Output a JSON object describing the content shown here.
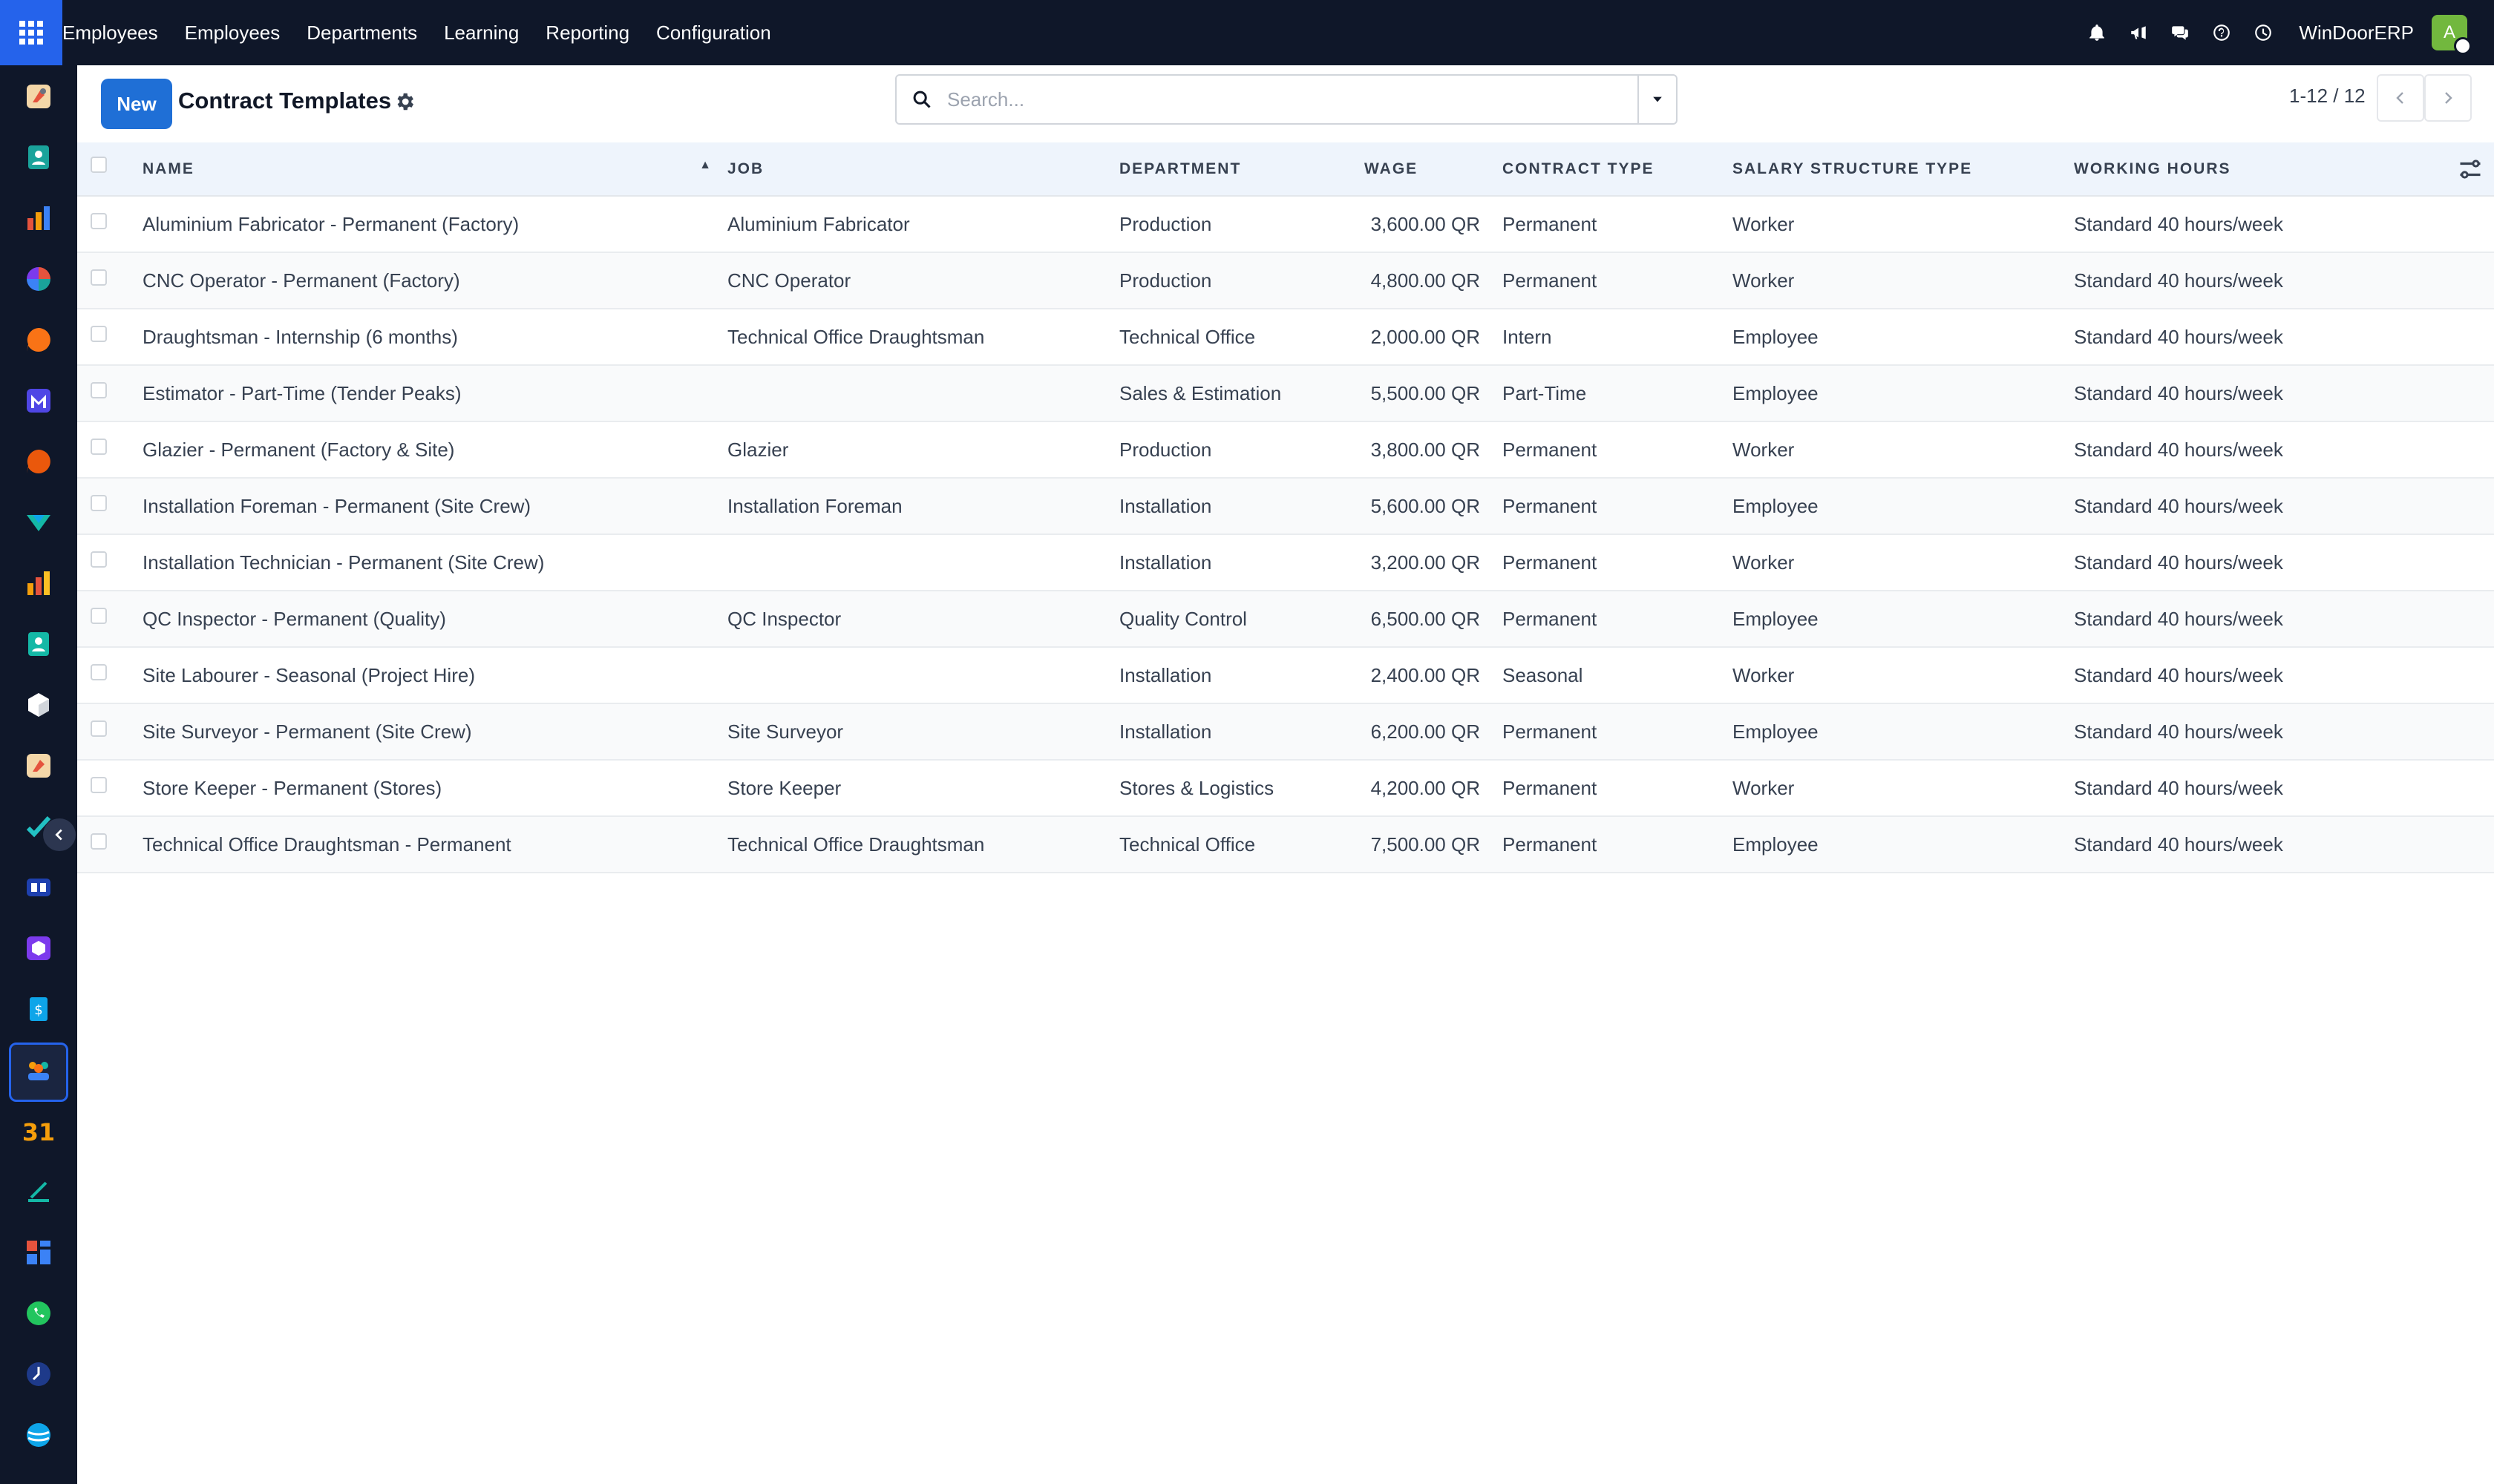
{
  "topbar": {
    "nav": [
      "Employees",
      "Employees",
      "Departments",
      "Learning",
      "Reporting",
      "Configuration"
    ],
    "company": "WinDoorERP",
    "avatar_letter": "A",
    "accent": "#2563eb",
    "icons": [
      "bell-icon",
      "megaphone-icon",
      "chat-icon",
      "help-icon",
      "clock-icon"
    ]
  },
  "sidebar": {
    "apps": [
      "studio-app-icon",
      "contacts-app-icon",
      "reporting-app-icon",
      "dashboard-app-icon",
      "discuss-app-icon",
      "mail-app-icon",
      "livechat-app-icon",
      "documents-app-icon",
      "statistics-app-icon",
      "contacts-app-icon",
      "inventory-app-icon",
      "studio-app-icon",
      "project-app-icon",
      "helpdesk-app-icon",
      "products-app-icon",
      "invoicing-app-icon",
      "employees-app-icon",
      "calendar-app-icon",
      "sign-app-icon",
      "kanban-app-icon",
      "whatsapp-app-icon",
      "timesheet-app-icon",
      "website-app-icon"
    ],
    "calendar_label": "31"
  },
  "control": {
    "new_label": "New",
    "title": "Contract Templates",
    "search_placeholder": "Search...",
    "pager": "1-12 / 12"
  },
  "table": {
    "columns": [
      "NAME",
      "JOB",
      "DEPARTMENT",
      "WAGE",
      "CONTRACT TYPE",
      "SALARY STRUCTURE TYPE",
      "WORKING HOURS"
    ],
    "rows": [
      {
        "name": "Aluminium Fabricator - Permanent (Factory)",
        "job": "Aluminium Fabricator",
        "department": "Production",
        "wage": "3,600.00 QR",
        "contract_type": "Permanent",
        "salary_structure": "Worker",
        "working_hours": "Standard 40 hours/week"
      },
      {
        "name": "CNC Operator - Permanent (Factory)",
        "job": "CNC Operator",
        "department": "Production",
        "wage": "4,800.00 QR",
        "contract_type": "Permanent",
        "salary_structure": "Worker",
        "working_hours": "Standard 40 hours/week"
      },
      {
        "name": "Draughtsman - Internship (6 months)",
        "job": "Technical Office Draughtsman",
        "department": "Technical Office",
        "wage": "2,000.00 QR",
        "contract_type": "Intern",
        "salary_structure": "Employee",
        "working_hours": "Standard 40 hours/week"
      },
      {
        "name": "Estimator - Part-Time (Tender Peaks)",
        "job": "",
        "department": "Sales & Estimation",
        "wage": "5,500.00 QR",
        "contract_type": "Part-Time",
        "salary_structure": "Employee",
        "working_hours": "Standard 40 hours/week"
      },
      {
        "name": "Glazier - Permanent (Factory & Site)",
        "job": "Glazier",
        "department": "Production",
        "wage": "3,800.00 QR",
        "contract_type": "Permanent",
        "salary_structure": "Worker",
        "working_hours": "Standard 40 hours/week"
      },
      {
        "name": "Installation Foreman - Permanent (Site Crew)",
        "job": "Installation Foreman",
        "department": "Installation",
        "wage": "5,600.00 QR",
        "contract_type": "Permanent",
        "salary_structure": "Employee",
        "working_hours": "Standard 40 hours/week"
      },
      {
        "name": "Installation Technician - Permanent (Site Crew)",
        "job": "",
        "department": "Installation",
        "wage": "3,200.00 QR",
        "contract_type": "Permanent",
        "salary_structure": "Worker",
        "working_hours": "Standard 40 hours/week"
      },
      {
        "name": "QC Inspector - Permanent (Quality)",
        "job": "QC Inspector",
        "department": "Quality Control",
        "wage": "6,500.00 QR",
        "contract_type": "Permanent",
        "salary_structure": "Employee",
        "working_hours": "Standard 40 hours/week"
      },
      {
        "name": "Site Labourer - Seasonal (Project Hire)",
        "job": "",
        "department": "Installation",
        "wage": "2,400.00 QR",
        "contract_type": "Seasonal",
        "salary_structure": "Worker",
        "working_hours": "Standard 40 hours/week"
      },
      {
        "name": "Site Surveyor - Permanent (Site Crew)",
        "job": "Site Surveyor",
        "department": "Installation",
        "wage": "6,200.00 QR",
        "contract_type": "Permanent",
        "salary_structure": "Employee",
        "working_hours": "Standard 40 hours/week"
      },
      {
        "name": "Store Keeper - Permanent (Stores)",
        "job": "Store Keeper",
        "department": "Stores & Logistics",
        "wage": "4,200.00 QR",
        "contract_type": "Permanent",
        "salary_structure": "Worker",
        "working_hours": "Standard 40 hours/week"
      },
      {
        "name": "Technical Office Draughtsman - Permanent",
        "job": "Technical Office Draughtsman",
        "department": "Technical Office",
        "wage": "7,500.00 QR",
        "contract_type": "Permanent",
        "salary_structure": "Employee",
        "working_hours": "Standard 40 hours/week"
      }
    ]
  }
}
